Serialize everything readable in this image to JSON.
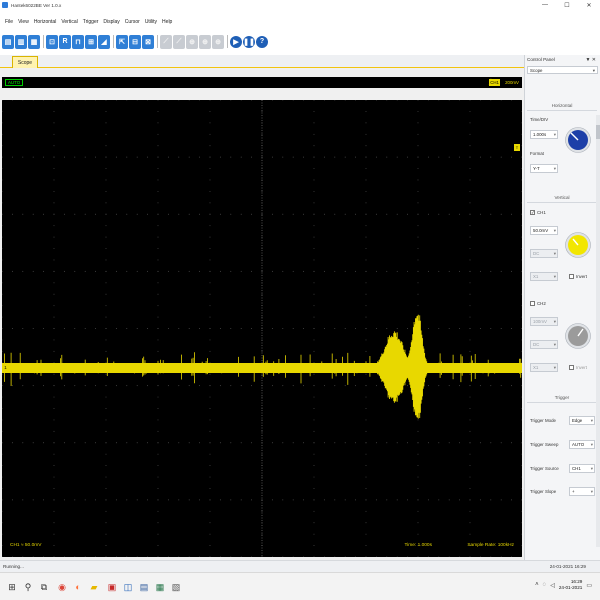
{
  "window": {
    "title": "Hantek6022BE Ver 1.0.x",
    "controls": [
      "—",
      "☐",
      "✕"
    ]
  },
  "menu": [
    "File",
    "View",
    "Horizontal",
    "Vertical",
    "Trigger",
    "Display",
    "Cursor",
    "Utility",
    "Help"
  ],
  "toolbar": {
    "icons": [
      "open-icon",
      "save-icon",
      "print-icon",
      "run-icon",
      "r-icon",
      "pulse-icon",
      "h-icon",
      "ramp-icon",
      "cursor-icon",
      "fft-icon",
      "math-icon",
      "disabled-icon-1",
      "disabled-icon-2",
      "disabled-icon-3",
      "disabled-icon-4",
      "disabled-icon-5",
      "play-icon",
      "stop-icon",
      "help-icon"
    ]
  },
  "tabs": {
    "active": "Scope"
  },
  "scope": {
    "mode": "AUTO",
    "trigger_channel": "CH1",
    "trigger_level": "200mV",
    "channel_marker": "1",
    "trigger_marker": "T",
    "ch1_scale": "CH1 ≈ 50.0mV",
    "time_per_div": "Time: 1.000s",
    "sample_rate": "Sample Rate: 100kHz"
  },
  "control_panel": {
    "title": "Control Panel",
    "pin": "▼ ✕",
    "selector": "Scope",
    "horizontal": {
      "heading": "Horizontal",
      "timediv_label": "Time/DIV",
      "timediv_value": "1.000s",
      "format_label": "Format",
      "format_value": "Y-T"
    },
    "vertical": {
      "heading": "Vertical",
      "ch1_label": "CH1",
      "ch1_checked": "✓",
      "ch1_volts": "50.0mV",
      "ch1_coupling": "DC",
      "ch1_probe": "X1",
      "ch1_invert": "Invert",
      "ch2_label": "CH2",
      "ch2_volts": "100mV",
      "ch2_coupling": "DC",
      "ch2_probe": "X1",
      "ch2_invert": "Invert"
    },
    "trigger": {
      "heading": "Trigger",
      "mode_label": "Trigger Mode",
      "mode_value": "Edge",
      "sweep_label": "Trigger Sweep",
      "sweep_value": "AUTO",
      "source_label": "Trigger Source",
      "source_value": "CH1",
      "slope_label": "Trigger Slope",
      "slope_value": "+"
    }
  },
  "colors": {
    "trace": "#e8d800",
    "knob_horizontal": "#1d3fa8",
    "knob_ch1": "#f2e600",
    "knob_ch2": "#9b9b9b"
  },
  "status": {
    "text": "Running...",
    "time": "24-01-2021  16:29"
  },
  "taskbar": {
    "icons": [
      "windows-icon",
      "search-icon",
      "task-view-icon",
      "chrome-icon",
      "firefox-icon",
      "file-explorer-icon",
      "pdf-icon",
      "hantek-icon",
      "word-icon",
      "excel-icon",
      "other-app-icon"
    ],
    "clock_time": "16:29",
    "clock_date": "24-01-2021"
  }
}
